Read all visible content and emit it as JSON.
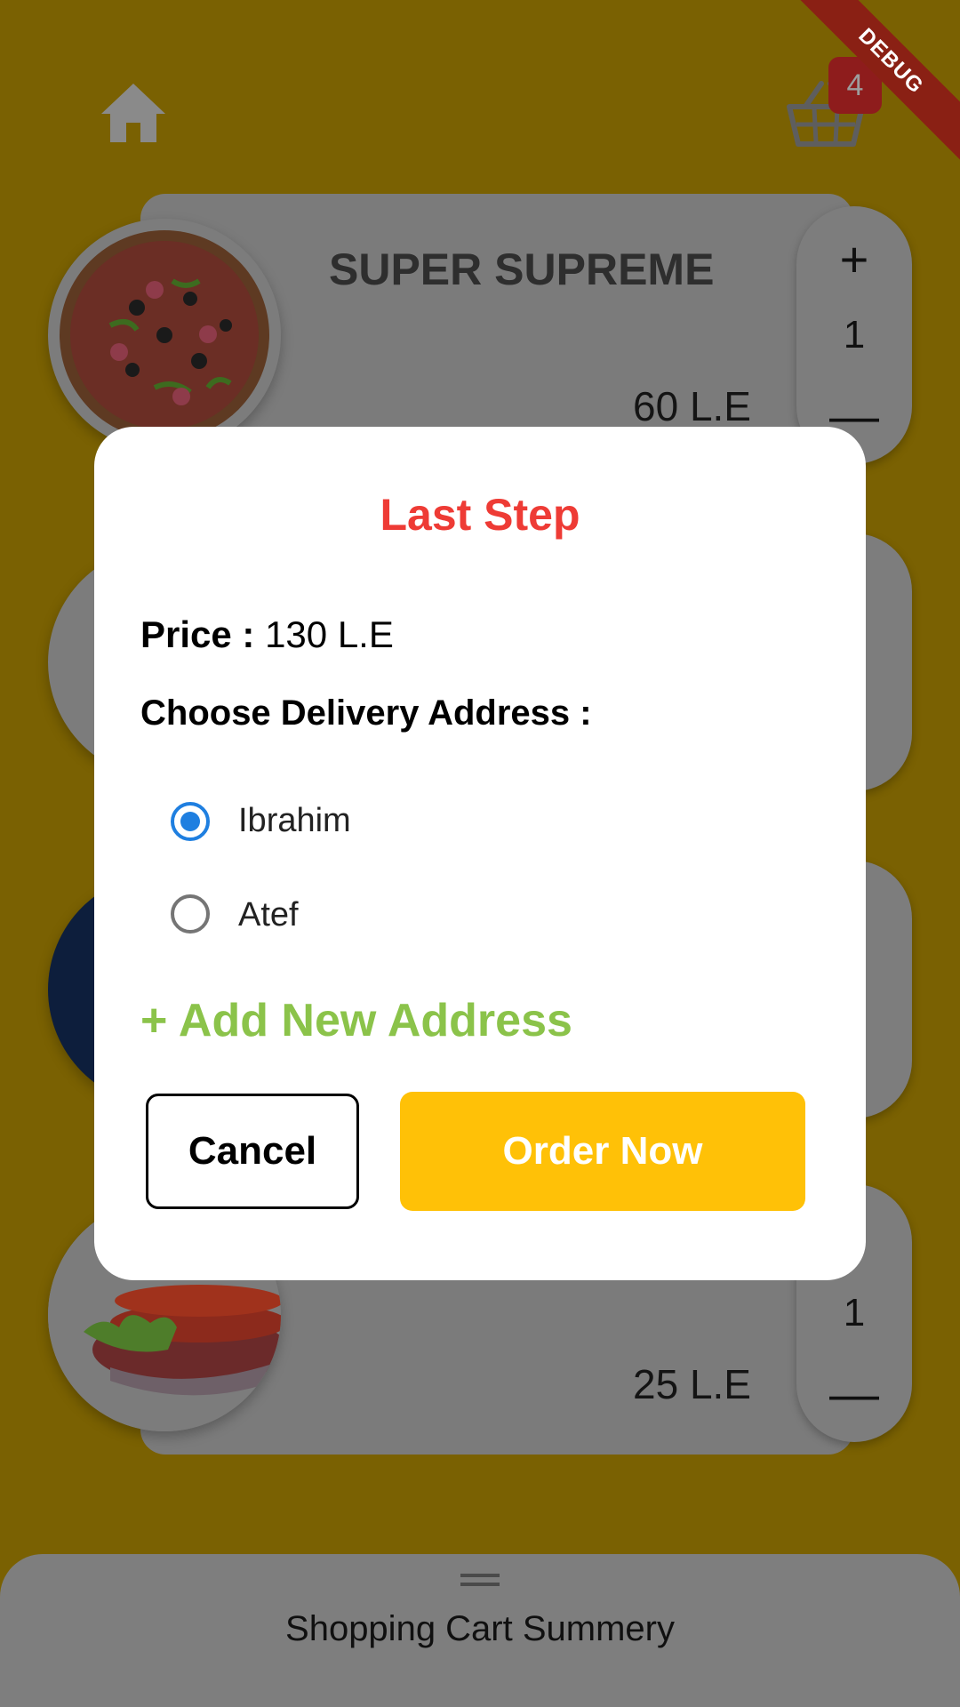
{
  "header": {
    "cart_count": "4",
    "debug_label": "DEBUG"
  },
  "cart_items": [
    {
      "title": "SUPER SUPREME",
      "price": "60 L.E",
      "quantity": "1"
    },
    {
      "title": "",
      "price": "",
      "quantity": ""
    },
    {
      "title": "",
      "price": "",
      "quantity": ""
    },
    {
      "title": "",
      "price": "25 L.E",
      "quantity": "1"
    }
  ],
  "qty_controls": {
    "plus": "+",
    "minus": "—"
  },
  "dialog": {
    "title": "Last Step",
    "price_label": "Price :",
    "price_value": "130 L.E",
    "address_label": "Choose Delivery Address :",
    "addresses": [
      {
        "label": "Ibrahim",
        "selected": true
      },
      {
        "label": "Atef",
        "selected": false
      }
    ],
    "add_address": "+ Add New Address",
    "cancel_label": "Cancel",
    "order_label": "Order Now"
  },
  "bottom_sheet": {
    "title": "Shopping Cart Summery"
  },
  "colors": {
    "accent_yellow": "#ffc107",
    "title_red": "#ee3b35",
    "add_green": "#8bc34a",
    "radio_blue": "#1f7fe0"
  }
}
